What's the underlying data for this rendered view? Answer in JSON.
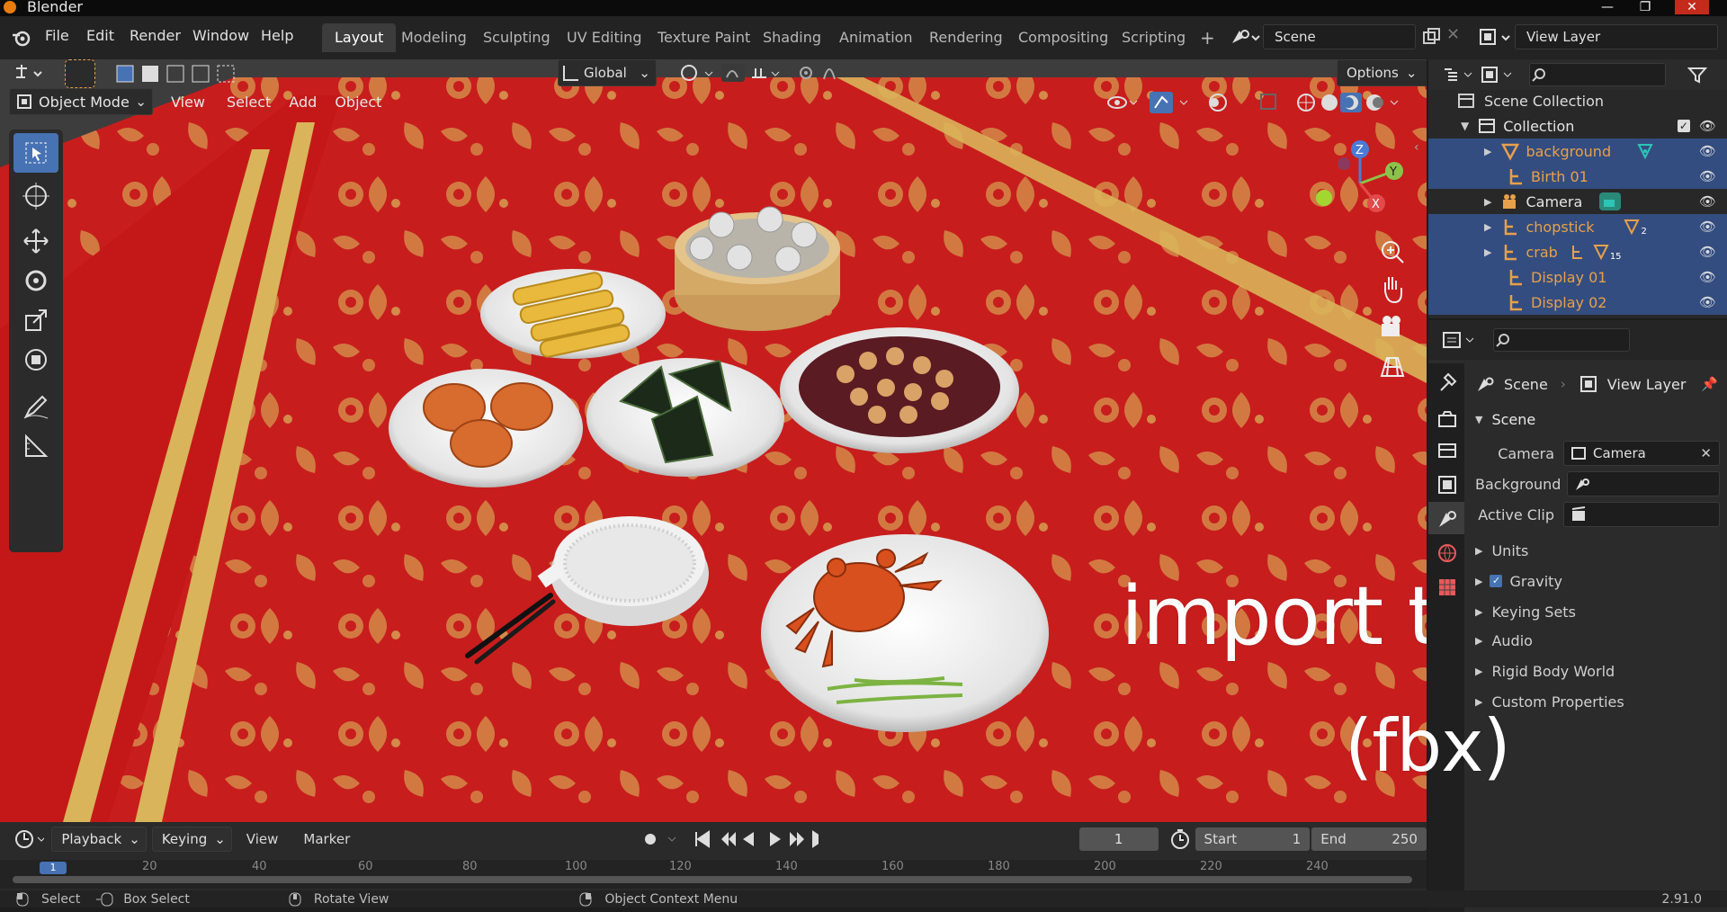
{
  "app": {
    "title": "Blender",
    "version": "2.91.0"
  },
  "window_controls": {
    "minimize": "—",
    "maximize": "❐",
    "close": "✕"
  },
  "menu": [
    "File",
    "Edit",
    "Render",
    "Window",
    "Help"
  ],
  "workspaces": [
    "Layout",
    "Modeling",
    "Sculpting",
    "UV Editing",
    "Texture Paint",
    "Shading",
    "Animation",
    "Rendering",
    "Compositing",
    "Scripting"
  ],
  "add_workspace": "+",
  "scene_field": "Scene",
  "view_layer_field": "View Layer",
  "viewport": {
    "mode": "Object Mode",
    "menus": [
      "View",
      "Select",
      "Add",
      "Object"
    ],
    "transform_orientation": "Global",
    "options_label": "Options",
    "gizmo_axes": {
      "x": "X",
      "y": "Y",
      "z": "Z"
    }
  },
  "overlay": {
    "line1": "import to blender",
    "line2": "(fbx)"
  },
  "outliner": {
    "root": "Scene Collection",
    "collection": "Collection",
    "items": [
      {
        "name": "background",
        "badge": ""
      },
      {
        "name": "Birth 01",
        "badge": ""
      },
      {
        "name": "Camera",
        "badge": ""
      },
      {
        "name": "chopstick",
        "badge": "2"
      },
      {
        "name": "crab",
        "badge": "15"
      },
      {
        "name": "Display 01",
        "badge": ""
      },
      {
        "name": "Display 02",
        "badge": ""
      }
    ]
  },
  "properties": {
    "breadcrumb_scene": "Scene",
    "breadcrumb_view_layer": "View Layer",
    "panel_title": "Scene",
    "camera_label": "Camera",
    "camera_value": "Camera",
    "background_label": "Background ...",
    "active_clip_label": "Active Clip",
    "sections": [
      "Units",
      "Gravity",
      "Keying Sets",
      "Audio",
      "Rigid Body World",
      "Custom Properties"
    ]
  },
  "timeline": {
    "menus": [
      "Playback",
      "Keying",
      "View",
      "Marker"
    ],
    "current_frame": "1",
    "start_label": "Start",
    "start_value": "1",
    "end_label": "End",
    "end_value": "250",
    "ruler_ticks": [
      "1",
      "20",
      "40",
      "60",
      "80",
      "100",
      "120",
      "140",
      "160",
      "180",
      "200",
      "220",
      "240"
    ]
  },
  "statusbar": [
    "Select",
    "Box Select",
    "Rotate View",
    "Object Context Menu"
  ],
  "colors": {
    "accent_blue": "#4772b3",
    "selected_row": "#334d80",
    "object_orange": "#e8a04a",
    "tablecloth_red": "#c81e1e",
    "gold": "#d9b45a"
  }
}
